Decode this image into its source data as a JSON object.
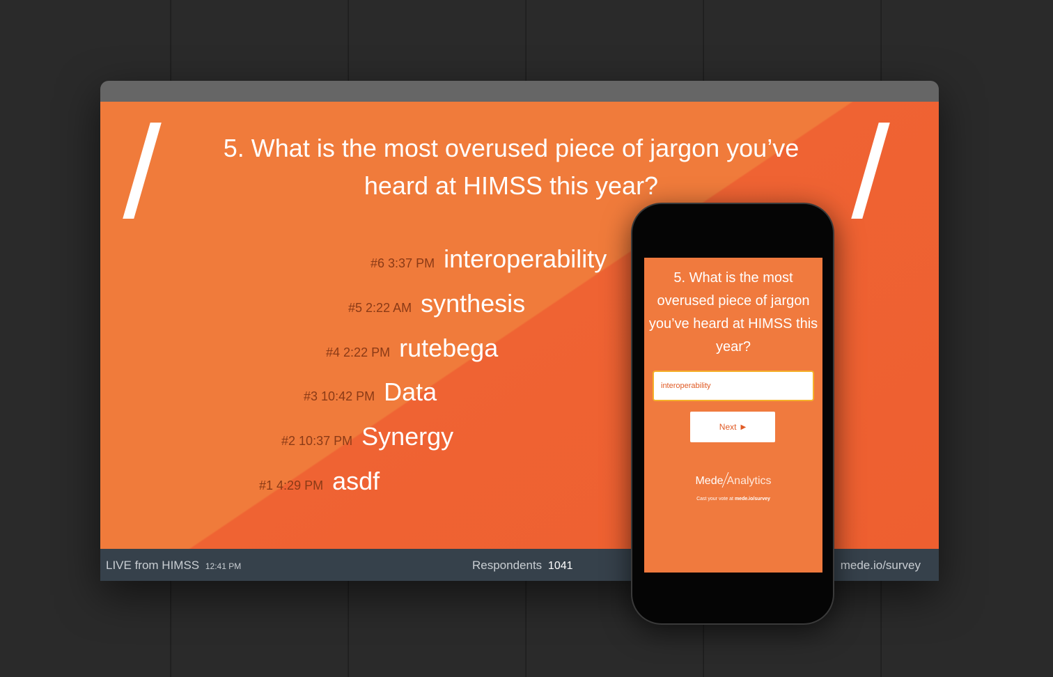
{
  "slide": {
    "question": "5. What is the most overused piece of jargon you’ve heard at HIMSS this year?",
    "answers": [
      {
        "rank": "#6",
        "time": "3:37 PM",
        "text": "interoperability"
      },
      {
        "rank": "#5",
        "time": "2:22 AM",
        "text": "synthesis"
      },
      {
        "rank": "#4",
        "time": "2:22 PM",
        "text": "rutebega"
      },
      {
        "rank": "#3",
        "time": "10:42 PM",
        "text": "Data"
      },
      {
        "rank": "#2",
        "time": "10:37 PM",
        "text": "Synergy"
      },
      {
        "rank": "#1",
        "time": "4:29 PM",
        "text": "asdf"
      }
    ]
  },
  "footer": {
    "live_label": "LIVE from HIMSS",
    "live_time": "12:41 PM",
    "respondents_label": "Respondents",
    "respondents_count": "1041",
    "url": "mede.io/survey"
  },
  "phone": {
    "question": "5. What is the most overused piece of jargon you’ve heard at HIMSS this year?",
    "input_value": "interoperability",
    "next_label": "Next",
    "logo_part1": "Mede",
    "logo_part2": "Analytics",
    "cast_prefix": "Cast your vote at",
    "cast_url": "mede.io/survey"
  },
  "colors": {
    "slide_orange": "#f07b3b",
    "slide_orange_dark": "#ee5f30",
    "footer_bg": "#36414b",
    "input_border": "#f5b02a"
  },
  "icons": {
    "next": "play-triangle-icon"
  }
}
